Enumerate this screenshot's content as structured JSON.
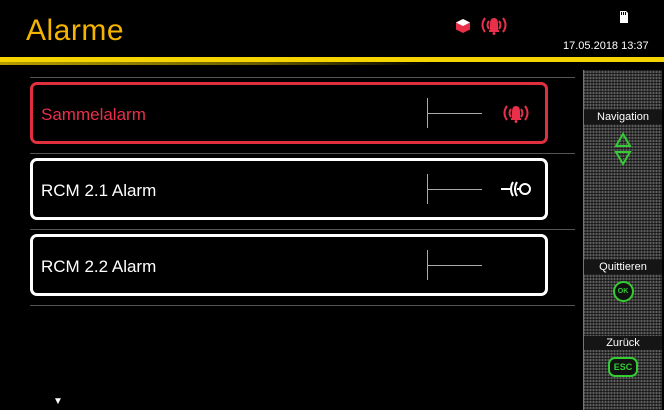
{
  "header": {
    "title": "Alarme",
    "datetime": "17.05.2018  13:37",
    "status_icons": [
      "system-cube-icon",
      "alarm-bell-icon"
    ],
    "storage_icon": "sd-card-icon"
  },
  "colors": {
    "title": "#f5b400",
    "accent_line": "#f5d400",
    "alarm_red": "#e8304a",
    "softkey_green": "#33cc33"
  },
  "alarms": [
    {
      "label": "Sammelalarm",
      "state": "active",
      "icon": "alarm-bell-icon"
    },
    {
      "label": "RCM 2.1 Alarm",
      "state": "normal",
      "icon": "rcm-sensor-icon"
    },
    {
      "label": "RCM 2.2 Alarm",
      "state": "normal",
      "icon": ""
    }
  ],
  "sidebar": {
    "navigation_label": "Navigation",
    "navigation_icon": "up-down-arrows-icon",
    "acknowledge_label": "Quittieren",
    "acknowledge_key": "OK",
    "back_label": "Zurück",
    "back_key": "ESC"
  },
  "list": {
    "more_indicator": "▼"
  }
}
